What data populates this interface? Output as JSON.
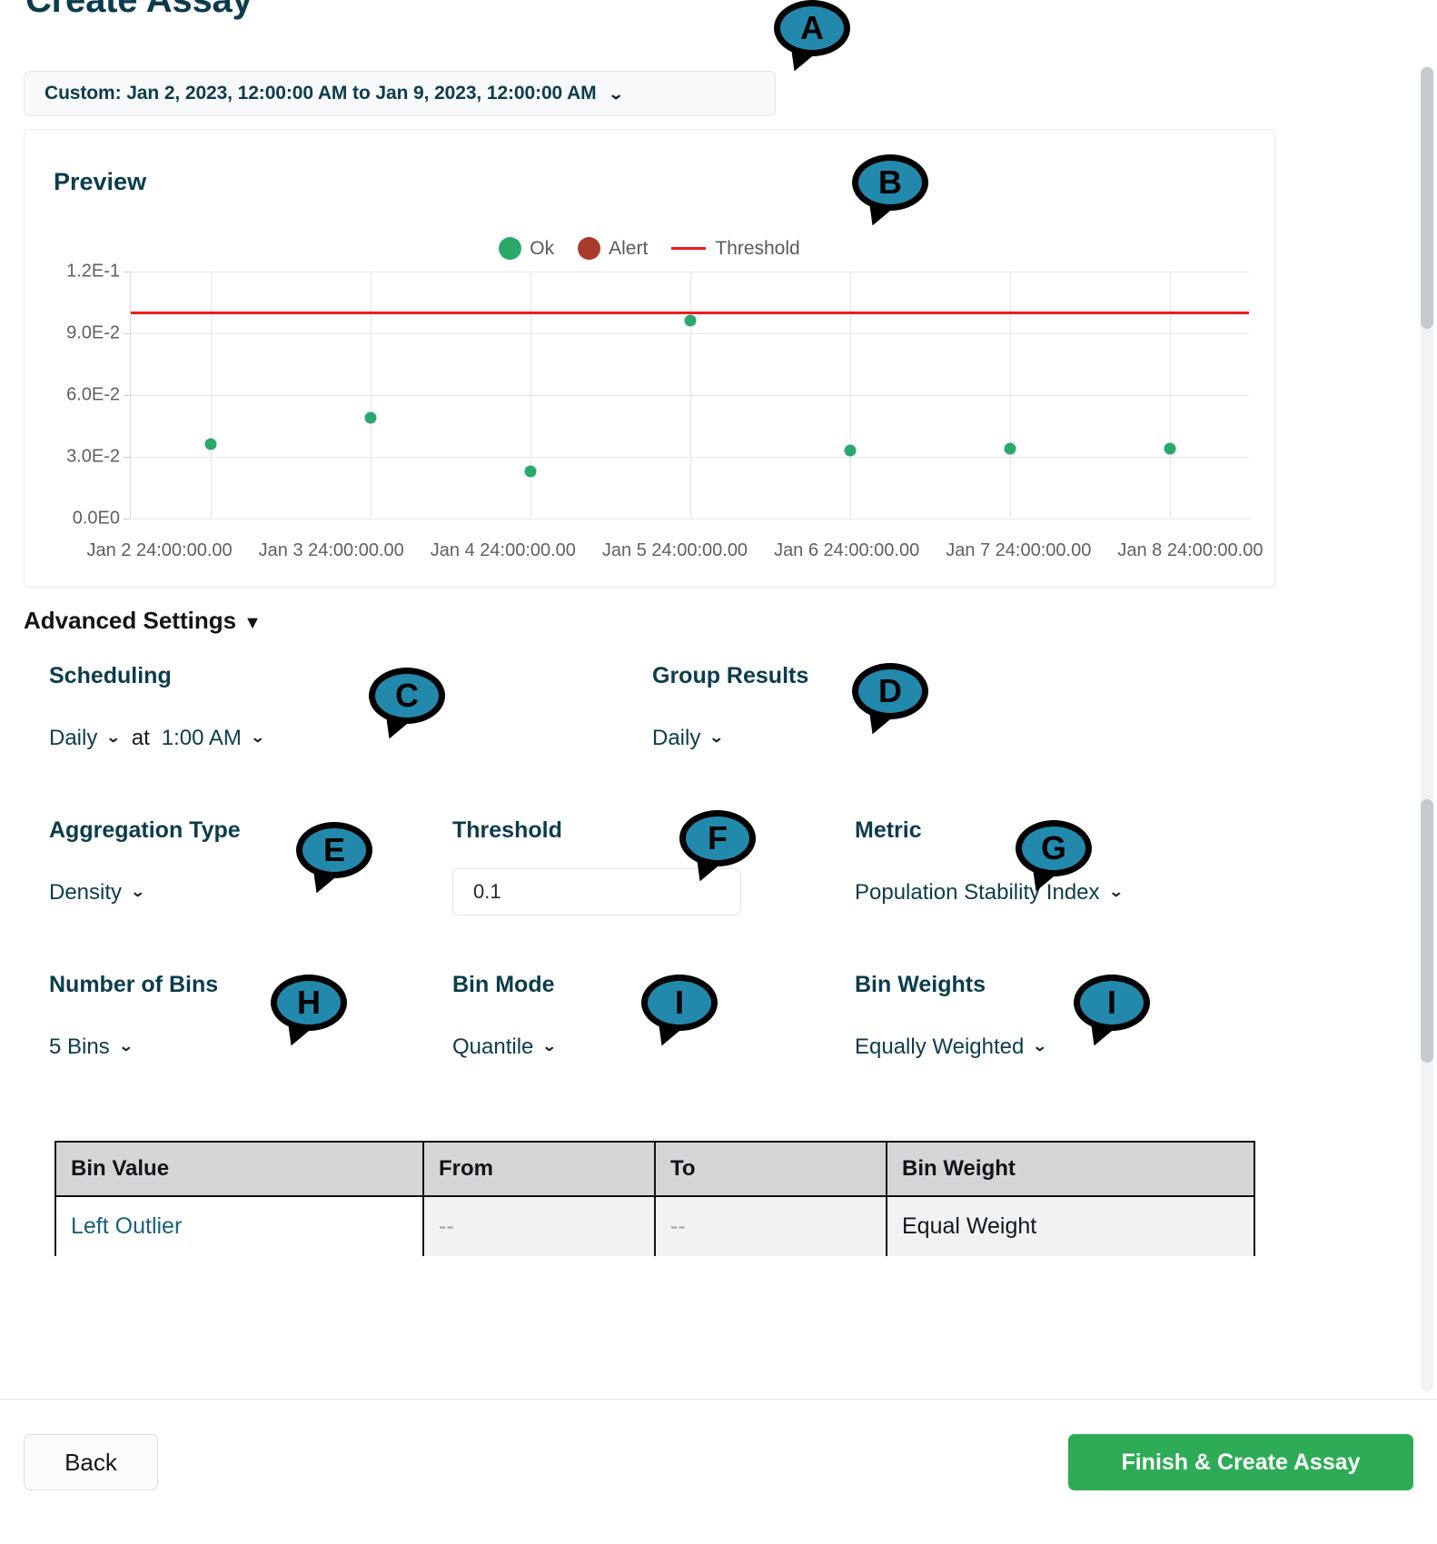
{
  "page": {
    "title": "Create Assay"
  },
  "date_range": {
    "label": "Custom: Jan 2, 2023, 12:00:00 AM to Jan 9, 2023, 12:00:00 AM",
    "caret": "⌄"
  },
  "preview": {
    "title": "Preview"
  },
  "chart_data": {
    "type": "scatter",
    "title": "Preview",
    "xlabel": "",
    "ylabel": "",
    "grid": true,
    "legend_position": "top-center",
    "legend": [
      {
        "label": "Ok",
        "color": "#2aa96b",
        "marker": "circle"
      },
      {
        "label": "Alert",
        "color": "#a83a2c",
        "marker": "circle"
      },
      {
        "label": "Threshold",
        "color": "#f01c1c",
        "marker": "line"
      }
    ],
    "ylim": [
      0.0,
      0.12
    ],
    "yticks": [
      "0.0E0",
      "3.0E-2",
      "6.0E-2",
      "9.0E-2",
      "1.2E-1"
    ],
    "ytick_values": [
      0.0,
      0.03,
      0.06,
      0.09,
      0.12
    ],
    "categories": [
      "Jan 2 24:00:00.00",
      "Jan 3 24:00:00.00",
      "Jan 4 24:00:00.00",
      "Jan 5 24:00:00.00",
      "Jan 6 24:00:00.00",
      "Jan 7 24:00:00.00",
      "Jan 8 24:00:00.00"
    ],
    "series": [
      {
        "name": "Ok",
        "color": "#2aa96b",
        "values": [
          0.036,
          0.049,
          0.023,
          0.096,
          0.033,
          0.034,
          0.034
        ]
      }
    ],
    "threshold": {
      "name": "Threshold",
      "color": "#f01c1c",
      "value": 0.1
    }
  },
  "advanced_settings": {
    "header": "Advanced Settings",
    "caret": "▼",
    "scheduling": {
      "label": "Scheduling",
      "frequency": "Daily",
      "at_text": "at",
      "time": "1:00 AM"
    },
    "group_results": {
      "label": "Group Results",
      "value": "Daily"
    },
    "aggregation_type": {
      "label": "Aggregation Type",
      "value": "Density"
    },
    "threshold": {
      "label": "Threshold",
      "value": "0.1",
      "placeholder": "Threshold"
    },
    "metric": {
      "label": "Metric",
      "value": "Population Stability Index"
    },
    "number_of_bins": {
      "label": "Number of Bins",
      "value": "5 Bins"
    },
    "bin_mode": {
      "label": "Bin Mode",
      "value": "Quantile"
    },
    "bin_weights": {
      "label": "Bin Weights",
      "value": "Equally Weighted"
    }
  },
  "bin_table": {
    "columns": [
      "Bin Value",
      "From",
      "To",
      "Bin Weight"
    ],
    "rows": [
      {
        "bin_value": "Left Outlier",
        "from": "--",
        "to": "--",
        "bin_weight": "Equal Weight"
      }
    ]
  },
  "footer": {
    "back_label": "Back",
    "finish_label": "Finish & Create Assay"
  },
  "callouts": [
    {
      "id": "A",
      "label": "A"
    },
    {
      "id": "B",
      "label": "B"
    },
    {
      "id": "C",
      "label": "C"
    },
    {
      "id": "D",
      "label": "D"
    },
    {
      "id": "E",
      "label": "E"
    },
    {
      "id": "F",
      "label": "F"
    },
    {
      "id": "G",
      "label": "G"
    },
    {
      "id": "H",
      "label": "H"
    },
    {
      "id": "I1",
      "label": "I"
    },
    {
      "id": "I2",
      "label": "I"
    }
  ],
  "colors": {
    "brand_dark": "#0b3c4d",
    "ok": "#2aa96b",
    "alert": "#a83a2c",
    "threshold": "#f01c1c",
    "primary_button": "#2eab55",
    "callout": "#2389ac"
  }
}
